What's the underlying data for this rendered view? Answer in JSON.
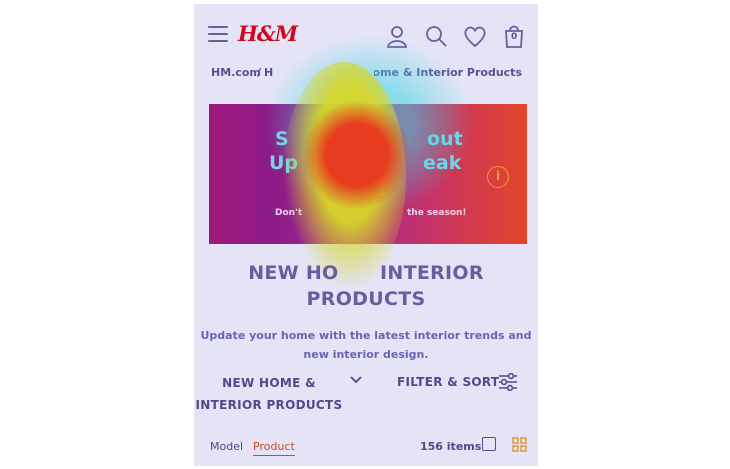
{
  "header": {
    "logo": "H&M",
    "basket_count": "0"
  },
  "breadcrumb": {
    "home": "HM.com",
    "separator": "/",
    "second": "H",
    "current": "New Home & Interior Products"
  },
  "banner": {
    "line1_left": "S",
    "line1_right": "out",
    "line2_left": "Up",
    "line2_right": "eak",
    "line3": "S",
    "line4_left": "Don't",
    "line4_right": "the season!"
  },
  "title": {
    "line1_left": "NEW",
    "line1_mid": "HO",
    "line1_right": "INTERIOR",
    "line2": "PRODUCTS"
  },
  "description": {
    "line1": "Update your home with the latest interior trends and",
    "line2": "new interior design."
  },
  "toolbar": {
    "category_line1": "NEW HOME &",
    "category_line2": "INTERIOR PRODUCTS",
    "filter_label": "FILTER & SORT"
  },
  "view": {
    "tab_model": "Model",
    "tab_product": "Product",
    "items_count": "156 items"
  },
  "colors": {
    "brand": "#cc071e",
    "active_tab": "#cc4a1e",
    "text": "#52488a"
  }
}
